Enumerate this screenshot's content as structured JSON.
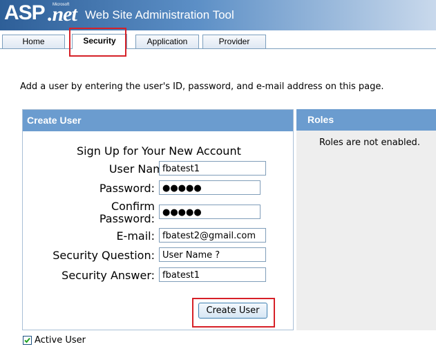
{
  "header": {
    "logo_asp": "ASP",
    "logo_net": ".net",
    "logo_ms": "Microsoft",
    "title": "Web Site Administration Tool"
  },
  "tabs": [
    {
      "label": "Home"
    },
    {
      "label": "Security"
    },
    {
      "label": "Application"
    },
    {
      "label": "Provider"
    }
  ],
  "active_tab": "Security",
  "intro": "Add a user by entering the user's ID, password, and e-mail address on this page.",
  "create_user": {
    "panel_title": "Create User",
    "form_title": "Sign Up for Your New Account",
    "labels": {
      "user_name": "User Name:",
      "password": "Password:",
      "confirm_1": "Confirm",
      "confirm_2": "Password:",
      "email": "E-mail:",
      "question": "Security Question:",
      "answer": "Security Answer:"
    },
    "values": {
      "user_name": "fbatest1",
      "password": "●●●●●",
      "confirm_password": "●●●●●",
      "email": "fbatest2@gmail.com",
      "question": "User Name ?",
      "answer": "fbatest1"
    },
    "submit_label": "Create User"
  },
  "roles": {
    "panel_title": "Roles",
    "message": "Roles are not enabled."
  },
  "active_user": {
    "label": "Active User",
    "checked": true
  },
  "colors": {
    "header_dark": "#2e5f98",
    "panel_header": "#6b9ccf",
    "highlight": "#d62027"
  }
}
